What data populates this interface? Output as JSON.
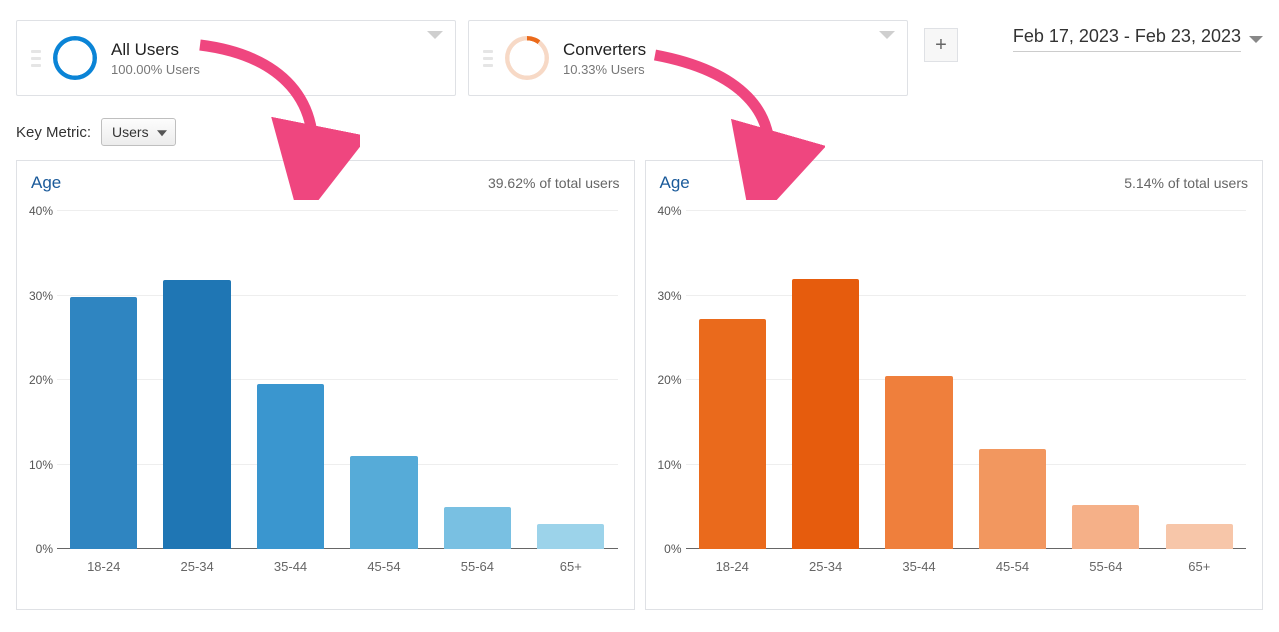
{
  "segments": {
    "all_users": {
      "title": "All Users",
      "sub": "100.00% Users",
      "ring_color": "#0b84d6",
      "ring_pct": 100
    },
    "converters": {
      "title": "Converters",
      "sub": "10.33% Users",
      "ring_color": "#eb6a1a",
      "ring_bg": "#f7d9c6",
      "ring_pct": 10.33
    }
  },
  "add_segment_glyph": "+",
  "date_range": "Feb 17, 2023 - Feb 23, 2023",
  "key_metric": {
    "label": "Key Metric:",
    "value": "Users"
  },
  "chart_data": [
    {
      "type": "bar",
      "id": "age_all_users",
      "title": "Age",
      "subtitle": "39.62% of total users",
      "categories": [
        "18-24",
        "25-34",
        "35-44",
        "45-54",
        "55-64",
        "65+"
      ],
      "values": [
        29.8,
        31.8,
        19.5,
        11.0,
        5.0,
        3.0
      ],
      "ylabel": "%",
      "ylim": [
        0,
        40
      ],
      "yticks": [
        0,
        10,
        20,
        30,
        40
      ],
      "ytick_labels": [
        "0%",
        "10%",
        "20%",
        "30%",
        "40%"
      ],
      "bar_colors": [
        "#2f85c1",
        "#1f76b4",
        "#3a96cf",
        "#56abd8",
        "#79c0e2",
        "#9cd3ea"
      ]
    },
    {
      "type": "bar",
      "id": "age_converters",
      "title": "Age",
      "subtitle": "5.14% of total users",
      "categories": [
        "18-24",
        "25-34",
        "35-44",
        "45-54",
        "55-64",
        "65+"
      ],
      "values": [
        27.2,
        32.0,
        20.5,
        11.8,
        5.2,
        3.0
      ],
      "ylabel": "%",
      "ylim": [
        0,
        40
      ],
      "yticks": [
        0,
        10,
        20,
        30,
        40
      ],
      "ytick_labels": [
        "0%",
        "10%",
        "20%",
        "30%",
        "40%"
      ],
      "bar_colors": [
        "#ea6a1c",
        "#e65c0d",
        "#ef7f3c",
        "#f2975f",
        "#f5b088",
        "#f7c6a9"
      ]
    }
  ]
}
